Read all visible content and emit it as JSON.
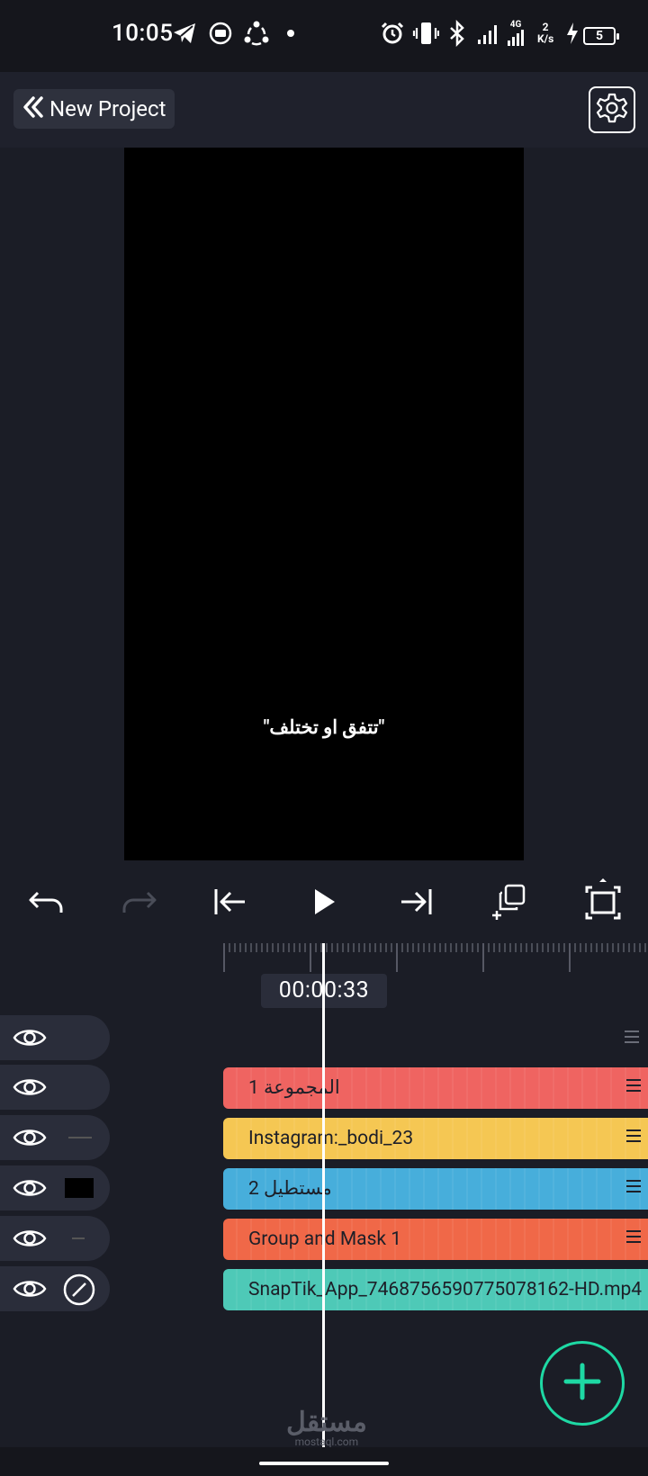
{
  "status_bar": {
    "time": "10:05",
    "net_type": "4G",
    "net_speed_value": "2",
    "net_speed_unit": "K/s",
    "battery": "5",
    "icons": [
      "telegram-icon",
      "media-icon",
      "share-app-icon",
      "dot-icon",
      "alarm-icon",
      "vibrate-icon",
      "bluetooth-icon",
      "signal-icon",
      "signal-4g-icon",
      "charging-icon"
    ]
  },
  "app_bar": {
    "back_label": "New Project",
    "settings_icon": "gear-icon"
  },
  "preview": {
    "caption": "\"تتفق او تختلف\""
  },
  "controls": [
    "undo-icon",
    "redo-icon",
    "jump-start-icon",
    "play-icon",
    "jump-end-icon",
    "duplicate-icon",
    "fullscreen-icon"
  ],
  "timeline": {
    "timecode": "00:00:33",
    "layers": [
      {
        "label": "المجموعة 1",
        "color": "#ef6461"
      },
      {
        "label": "Instagram:_bodi_23",
        "color": "#f5c753"
      },
      {
        "label": "مستطيل 2",
        "color": "#47aedb"
      },
      {
        "label": "Group and Mask 1",
        "color": "#f06848"
      },
      {
        "label": "SnapTik_App_7468756590775078162-HD.mp4",
        "color": "#4ec9b7"
      }
    ]
  },
  "fab_icon": "plus-icon",
  "watermark": {
    "arabic": "مستقل",
    "latin": "mostaql.com"
  }
}
